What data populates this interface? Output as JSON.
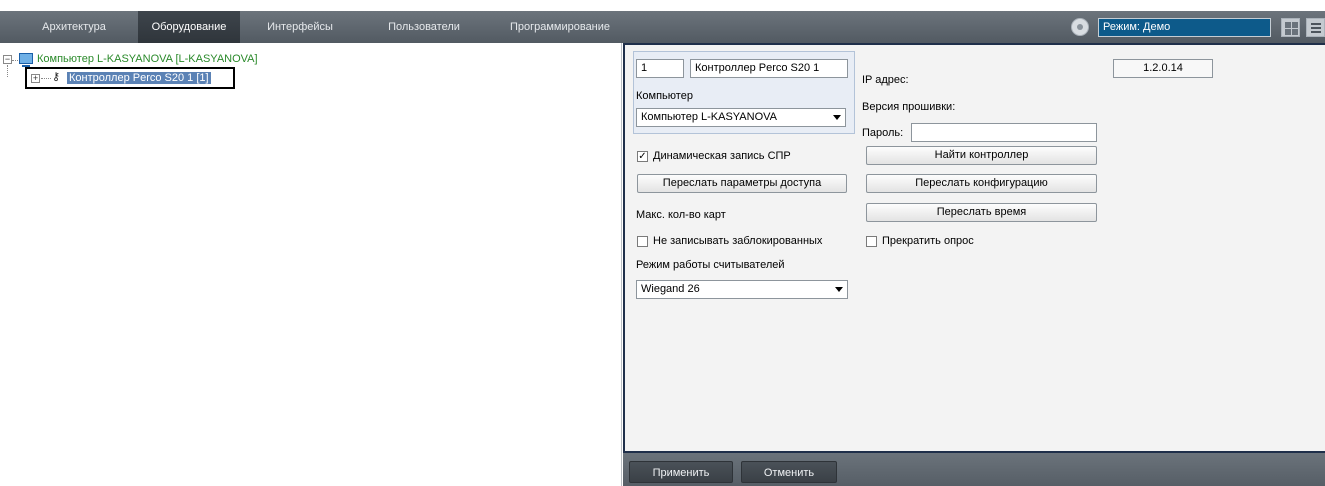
{
  "menu": {
    "tabs": [
      {
        "label": "Архитектура"
      },
      {
        "label": "Оборудование"
      },
      {
        "label": "Интерфейсы"
      },
      {
        "label": "Пользователи"
      },
      {
        "label": "Программирование"
      }
    ],
    "active_index": 1,
    "mode_text": "Режим: Демо"
  },
  "tree": {
    "root_label": "Компьютер L-KASYANOVA [L-KASYANOVA]",
    "child_label": "Контроллер Perco S20 1 [1]"
  },
  "panel": {
    "id_value": "1",
    "name_value": "Контроллер Perco S20 1",
    "computer_label": "Компьютер",
    "computer_value": "Компьютер L-KASYANOVA",
    "ip_label": "IP адрес:",
    "ip_value": "1.2.0.14",
    "firmware_label": "Версия прошивки:",
    "password_label": "Пароль:",
    "password_value": "",
    "dynamic_record_label": "Динамическая запись СПР",
    "dynamic_record_checked": true,
    "find_controller_button": "Найти контроллер",
    "send_access_button": "Переслать параметры доступа",
    "send_config_button": "Переслать конфигурацию",
    "max_cards_label": "Макс. кол-во карт",
    "send_time_button": "Переслать время",
    "no_blocked_label": "Не записывать заблокированных",
    "stop_polling_label": "Прекратить опрос",
    "reader_mode_label": "Режим работы считывателей",
    "reader_mode_value": "Wiegand 26"
  },
  "bottom": {
    "apply": "Применить",
    "cancel": "Отменить"
  },
  "colors": {
    "topbar": "#5f676f",
    "active_tab": "#363c42",
    "mode_box": "#0d5a8a",
    "selection": "#5b82b5",
    "panel_border": "#1f2f4a"
  }
}
